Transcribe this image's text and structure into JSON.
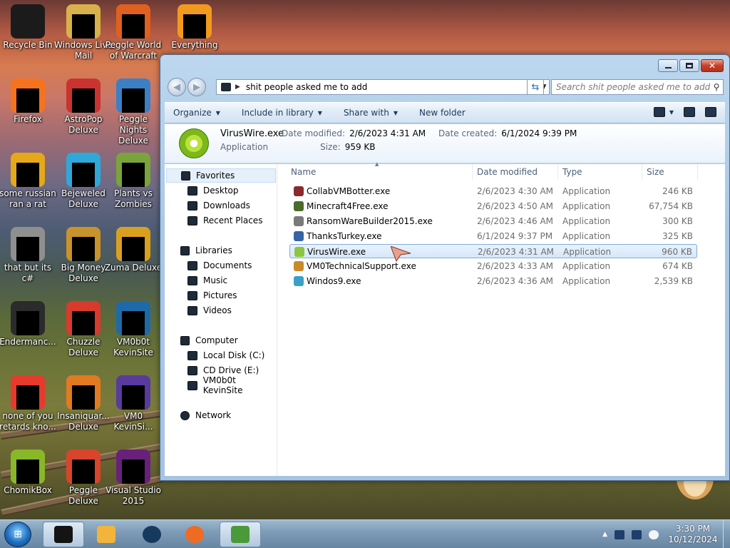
{
  "desktop": {
    "icons": [
      {
        "label": "Recycle Bin",
        "color": "#1b1b1b"
      },
      {
        "label": "Windows Live Mail",
        "color": "#d8b14a"
      },
      {
        "label": "Peggle World of Warcraft",
        "color": "#e0601f"
      },
      {
        "label": "Everything",
        "color": "#f29a1d"
      },
      {
        "label": "Firefox",
        "color": "#f5731f"
      },
      {
        "label": "AstroPop Deluxe",
        "color": "#c93330"
      },
      {
        "label": "Peggle Nights Deluxe",
        "color": "#3b7fc4"
      },
      {
        "label": "some russian ran a rat",
        "color": "#e5a819"
      },
      {
        "label": "Bejeweled Deluxe",
        "color": "#2fa8d9"
      },
      {
        "label": "Plants vs Zombies",
        "color": "#7aa43b"
      },
      {
        "label": "that but its c#",
        "color": "#8f8f8f"
      },
      {
        "label": "Big Money Deluxe",
        "color": "#c7932a"
      },
      {
        "label": "Zuma Deluxe",
        "color": "#d9a020"
      },
      {
        "label": "Endermanc...",
        "color": "#2b2b2b"
      },
      {
        "label": "Chuzzle Deluxe",
        "color": "#d83a2d"
      },
      {
        "label": "VM0b0t KevinSite",
        "color": "#1e6aa8"
      },
      {
        "label": "none of you retards kno...",
        "color": "#e53a2c"
      },
      {
        "label": "Insaniquar... Deluxe",
        "color": "#e27a22"
      },
      {
        "label": "VM0 KevinSi...",
        "color": "#593a9e"
      },
      {
        "label": "ChomikBox",
        "color": "#88b828"
      },
      {
        "label": "Peggle Deluxe",
        "color": "#d9442c"
      },
      {
        "label": "Visual Studio 2015",
        "color": "#68217a"
      }
    ]
  },
  "window": {
    "address": {
      "path": "shit people asked me to add"
    },
    "search": {
      "placeholder": "Search shit people asked me to add"
    },
    "toolbar": {
      "organize": "Organize",
      "include": "Include in library",
      "share": "Share with",
      "new_folder": "New folder"
    },
    "details": {
      "name": "VirusWire.exe",
      "type": "Application",
      "date_modified_label": "Date modified:",
      "date_modified": "2/6/2023 4:31 AM",
      "date_created_label": "Date created:",
      "date_created": "6/1/2024 9:39 PM",
      "size_label": "Size:",
      "size": "959 KB"
    },
    "nav": {
      "favorites": "Favorites",
      "desktop": "Desktop",
      "downloads": "Downloads",
      "recent": "Recent Places",
      "libraries": "Libraries",
      "documents": "Documents",
      "music": "Music",
      "pictures": "Pictures",
      "videos": "Videos",
      "computer": "Computer",
      "local_disk": "Local Disk (C:)",
      "cd_drive": "CD Drive (E:)",
      "kevinsite": "VM0b0t KevinSite",
      "network": "Network"
    },
    "columns": {
      "name": "Name",
      "date": "Date modified",
      "type": "Type",
      "size": "Size"
    },
    "files": [
      {
        "name": "CollabVMBotter.exe",
        "date": "2/6/2023 4:30 AM",
        "type": "Application",
        "size": "246 KB",
        "color": "#8b2a2a"
      },
      {
        "name": "Minecraft4Free.exe",
        "date": "2/6/2023 4:50 AM",
        "type": "Application",
        "size": "67,754 KB",
        "color": "#4a6b2a"
      },
      {
        "name": "RansomWareBuilder2015.exe",
        "date": "2/6/2023 4:46 AM",
        "type": "Application",
        "size": "300 KB",
        "color": "#7a7a7a"
      },
      {
        "name": "ThanksTurkey.exe",
        "date": "6/1/2024 9:37 PM",
        "type": "Application",
        "size": "325 KB",
        "color": "#3465a4"
      },
      {
        "name": "VirusWire.exe",
        "date": "2/6/2023 4:31 AM",
        "type": "Application",
        "size": "960 KB",
        "color": "#8cc63f",
        "selected": true
      },
      {
        "name": "VM0TechnicalSupport.exe",
        "date": "2/6/2023 4:33 AM",
        "type": "Application",
        "size": "674 KB",
        "color": "#c98a2a"
      },
      {
        "name": "Windos9.exe",
        "date": "2/6/2023 4:36 AM",
        "type": "Application",
        "size": "2,539 KB",
        "color": "#3aa0c9"
      }
    ]
  },
  "taskbar": {
    "time": "3:30 PM",
    "date": "10/12/2024"
  }
}
